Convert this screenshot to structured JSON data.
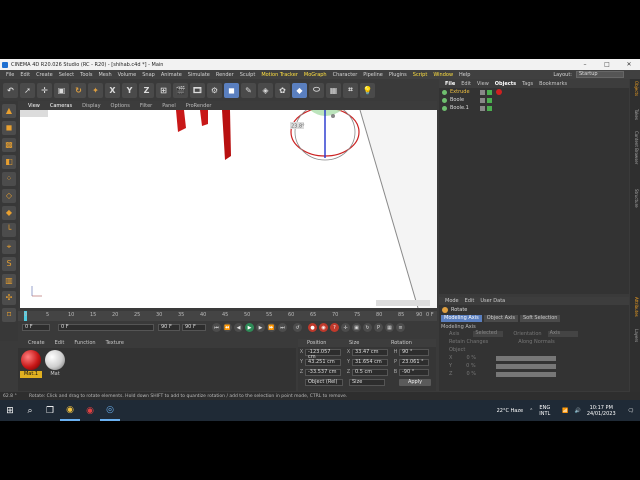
{
  "window": {
    "title": "CINEMA 4D R20.026 Studio (RC - R20) - [shihab.c4d *] - Main",
    "minimize": "–",
    "maximize": "□",
    "close": "✕"
  },
  "menubar": {
    "items": [
      "File",
      "Edit",
      "Create",
      "Select",
      "Tools",
      "Mesh",
      "Volume",
      "Snap",
      "Animate",
      "Simulate",
      "Render",
      "Sculpt",
      "Motion Tracker",
      "MoGraph",
      "Character",
      "Pipeline",
      "Plugins",
      "Script",
      "Window",
      "Help"
    ],
    "layout_label": "Layout:",
    "layout_value": "Startup"
  },
  "toolbar": {
    "undo": "↶",
    "x": "X",
    "y": "Y",
    "z": "Z"
  },
  "viewport_menu": {
    "items": [
      "View",
      "Cameras",
      "Display",
      "Options",
      "Filter",
      "Panel",
      "ProRender"
    ]
  },
  "viewport": {
    "gizmo_label": "23.8°"
  },
  "timeline": {
    "ticks": [
      "0",
      "5",
      "10",
      "15",
      "20",
      "25",
      "30",
      "35",
      "40",
      "45",
      "50",
      "55",
      "60",
      "65",
      "70",
      "75",
      "80",
      "85",
      "90"
    ],
    "end_label": "0 F"
  },
  "transport": {
    "start_frame": "0 F",
    "current_frame": "0 F",
    "end_frame": "90 F",
    "max_frame": "90 F"
  },
  "materials": {
    "menu": [
      "Create",
      "Edit",
      "Function",
      "Texture"
    ],
    "items": [
      {
        "name": "Mat.1",
        "color": "#c81818"
      },
      {
        "name": "Mat",
        "color": "#e8e8e8"
      }
    ]
  },
  "coordinates": {
    "headers": [
      "Position",
      "Size",
      "Rotation"
    ],
    "rows": [
      {
        "axis": "X",
        "pos": "-123.057 cm",
        "size_axis": "X",
        "size": "33.47 cm",
        "rot_axis": "H",
        "rot": "90 °"
      },
      {
        "axis": "Y",
        "pos": "43.251 cm",
        "size_axis": "Y",
        "size": "31.654 cm",
        "rot_axis": "P",
        "rot": "23.061 °"
      },
      {
        "axis": "Z",
        "pos": "-33.537 cm",
        "size_axis": "Z",
        "size": "0.5 cm",
        "rot_axis": "B",
        "rot": "-90 °"
      }
    ],
    "mode": "Object (Rel)",
    "size_mode": "Size",
    "apply": "Apply"
  },
  "object_manager": {
    "menu": [
      "File",
      "Edit",
      "View",
      "Objects",
      "Tags",
      "Bookmarks"
    ],
    "objects": [
      {
        "name": "Extrude",
        "icon_color": "#6fbf6f"
      },
      {
        "name": "Boole",
        "icon_color": "#6fbf6f"
      },
      {
        "name": "Boole.1",
        "icon_color": "#6fbf6f"
      }
    ]
  },
  "attributes": {
    "menu": [
      "Mode",
      "Edit",
      "User Data"
    ],
    "title": "Rotate",
    "tabs": [
      "Modeling Axis",
      "Object Axis",
      "Soft Selection"
    ],
    "section": "Modeling Axis",
    "axis_label": "Axis",
    "axis_value": "Selected",
    "orientation_label": "Orientation",
    "orientation_value": "Axis",
    "retain_label": "Retain Changes",
    "normals_label": "Along Normals",
    "object_label": "Object",
    "x_label": "X",
    "y_label": "Y",
    "z_label": "Z",
    "x_value": "0 %",
    "y_value": "0 %",
    "z_value": "0 %"
  },
  "side_tabs": [
    "Objects",
    "Takes",
    "Content Browser",
    "Structure",
    "Attributes",
    "Layers"
  ],
  "status": {
    "text": "Rotate: Click and drag to rotate elements. Hold down SHIFT to add to quantize rotation / add to the selection in point mode, CTRL to remove.",
    "time": "62.8 °"
  },
  "taskbar": {
    "weather": "22°C  Haze",
    "lang": "ENG",
    "lang2": "INTL",
    "time": "10:17 PM",
    "date": "24/01/2023"
  },
  "colors": {
    "accent": "#5a7fbf",
    "highlight": "#ffe040",
    "red_object": "#c81818"
  }
}
